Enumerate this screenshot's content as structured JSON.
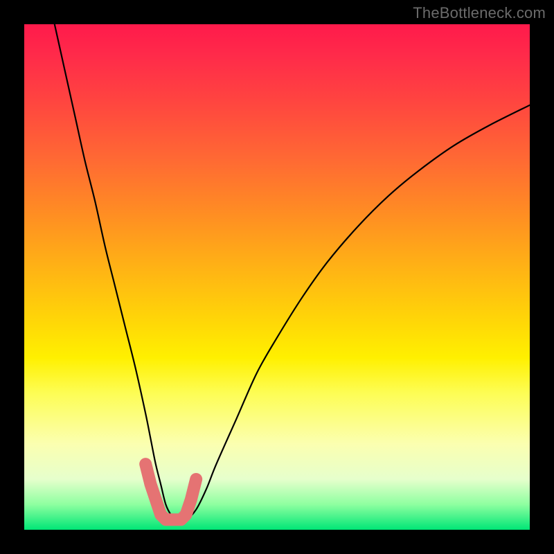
{
  "watermark": "TheBottleneck.com",
  "chart_data": {
    "type": "line",
    "title": "",
    "xlabel": "",
    "ylabel": "",
    "xlim": [
      0,
      100
    ],
    "ylim": [
      0,
      100
    ],
    "grid": false,
    "legend": false,
    "series": [
      {
        "name": "bottleneck-curve",
        "color": "#000000",
        "x": [
          6,
          8,
          10,
          12,
          14,
          16,
          18,
          20,
          22,
          24,
          25,
          26,
          27,
          28,
          29,
          30,
          32,
          34,
          36,
          38,
          42,
          46,
          50,
          55,
          60,
          66,
          72,
          78,
          85,
          92,
          100
        ],
        "y": [
          100,
          91,
          82,
          73,
          65,
          56,
          48,
          40,
          32,
          23,
          18,
          13,
          9,
          5,
          3,
          2,
          2,
          4,
          8,
          13,
          22,
          31,
          38,
          46,
          53,
          60,
          66,
          71,
          76,
          80,
          84
        ]
      },
      {
        "name": "optimal-band",
        "color": "#e57373",
        "x": [
          24,
          25,
          26,
          27,
          28,
          29,
          30,
          31,
          32,
          33,
          34
        ],
        "y": [
          13,
          9,
          6,
          3,
          2,
          2,
          2,
          2,
          3,
          6,
          10
        ]
      }
    ],
    "annotations": []
  },
  "colors": {
    "curve": "#000000",
    "optimal_marker": "#e57373",
    "frame": "#000000"
  }
}
